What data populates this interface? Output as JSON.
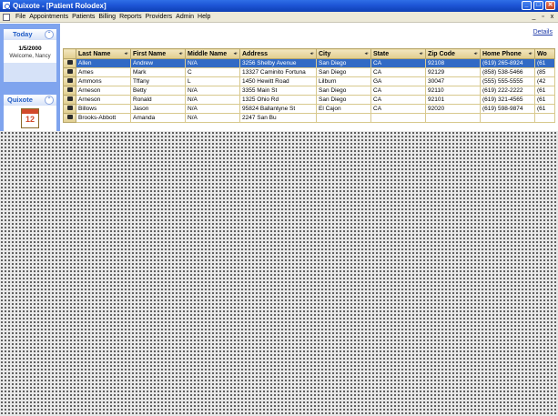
{
  "window": {
    "title": "Quixote - [Patient Rolodex]",
    "buttons": {
      "minimize": "_",
      "maximize": "□",
      "close": "✕"
    }
  },
  "menu": {
    "items": [
      "File",
      "Appointments",
      "Patients",
      "Billing",
      "Reports",
      "Providers",
      "Admin",
      "Help"
    ],
    "mdi": {
      "minimize": "_",
      "restore": "▫",
      "close": "x"
    }
  },
  "sidebar": {
    "today": {
      "title": "Today",
      "collapse": "⌃",
      "date": "1/5/2000",
      "welcome": "Welcome, Nancy"
    },
    "quixote": {
      "title": "Quixote",
      "collapse": "⌃",
      "calendar_number": "12"
    }
  },
  "main": {
    "details_link": "Details"
  },
  "grid": {
    "columns": [
      "Last Name",
      "First Name",
      "Middle Name",
      "Address",
      "City",
      "State",
      "Zip Code",
      "Home Phone",
      "Wo"
    ],
    "rows": [
      [
        "Allen",
        "Andrew",
        "N/A",
        "3256 Shelby Avenue",
        "San Diego",
        "CA",
        "92108",
        "(619) 265-8924",
        "(61"
      ],
      [
        "Ames",
        "Mark",
        "C",
        "13327 Caminito Fortuna",
        "San Diego",
        "CA",
        "92129",
        "(858) 538-5466",
        "(85"
      ],
      [
        "Ammons",
        "Tffany",
        "L",
        "1450 Hewitt Road",
        "Lilburn",
        "GA",
        "30047",
        "(555) 555-5555",
        "(42"
      ],
      [
        "Arneson",
        "Betty",
        "N/A",
        "3355 Main St",
        "San Diego",
        "CA",
        "92110",
        "(619) 222-2222",
        "(61"
      ],
      [
        "Arneson",
        "Ronald",
        "N/A",
        "1325 Ohio Rd",
        "San Diego",
        "CA",
        "92101",
        "(619) 321-4565",
        "(61"
      ],
      [
        "Billows",
        "Jason",
        "N/A",
        "95824 Ballantyne St",
        "El Cajon",
        "CA",
        "92020",
        "(619) 598-9874",
        "(61"
      ],
      [
        "Brooks-Abbott",
        "Amanda",
        "N/A",
        "2247 San Bu",
        "",
        "",
        "",
        "",
        ""
      ]
    ],
    "selected_row": 0
  }
}
